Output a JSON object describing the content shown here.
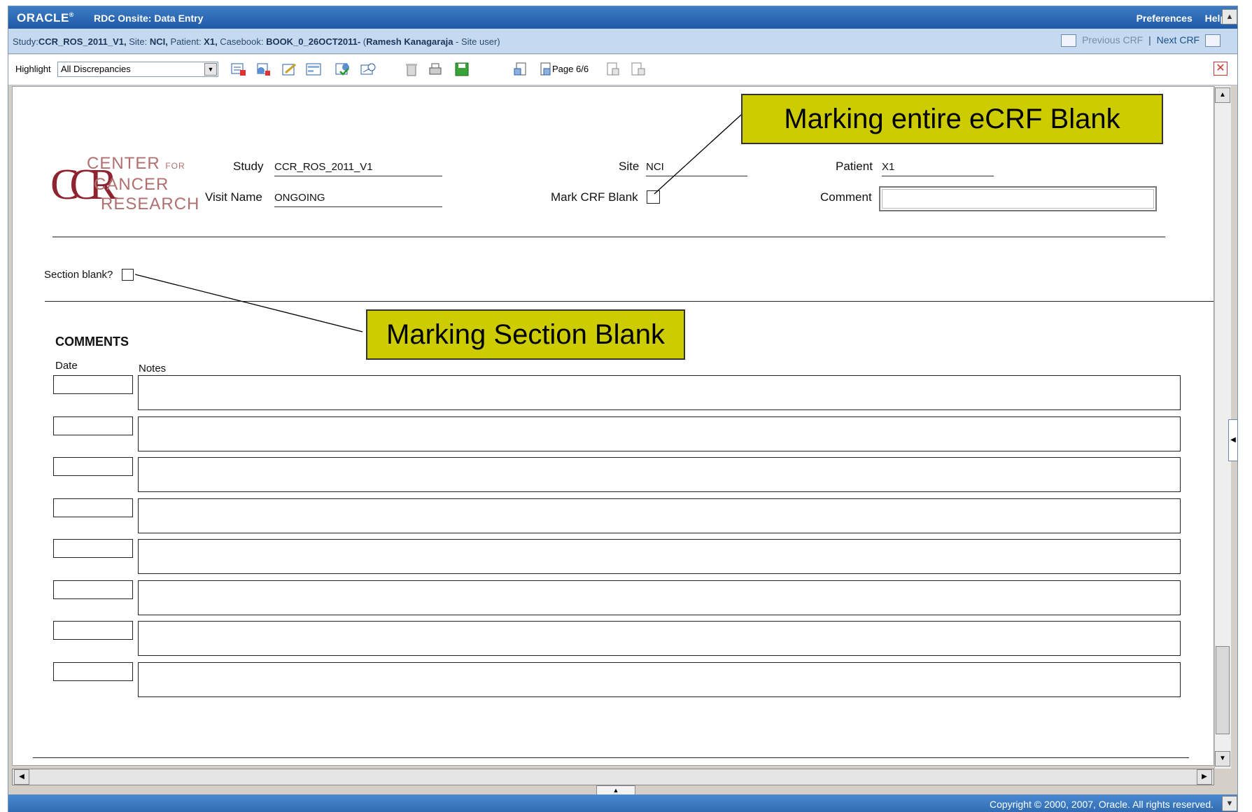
{
  "header": {
    "logo": "ORACLE",
    "logo_mark": "®",
    "app_title": "RDC Onsite: Data Entry",
    "preferences_label": "Preferences",
    "help_label": "Help"
  },
  "info_bar": {
    "study_prefix": "Study:",
    "study": "CCR_ROS_2011_V1,",
    "site_prefix": " Site: ",
    "site": "NCI,",
    "patient_prefix": " Patient: ",
    "patient": "X1,",
    "casebook_prefix": " Casebook: ",
    "casebook": "BOOK_0_26OCT2011-",
    "user_prefix": " (",
    "user": "Ramesh Kanagaraja",
    "role": " - Site user)",
    "previous_crf": "Previous CRF",
    "separator": "|",
    "next_crf": "Next CRF"
  },
  "toolbar": {
    "highlight_label": "Highlight",
    "highlight_value": "All Discrepancies",
    "page_label": "Page 6/6",
    "icons": [
      "add-discrepancy-icon",
      "add-investigator-comment-icon",
      "edit-icon",
      "audit-history-icon",
      "verify-icon",
      "approve-icon",
      "delete-icon",
      "print-icon",
      "save-icon",
      "first-page-icon",
      "previous-page-icon",
      "next-page-icon",
      "last-page-icon",
      "close-icon"
    ]
  },
  "form": {
    "logo_letters": "CCR",
    "logo_line1": "CENTER",
    "logo_line1_small": "FOR",
    "logo_line2": "CANCER",
    "logo_line3": "RESEARCH",
    "study_label": "Study",
    "study_value": "CCR_ROS_2011_V1",
    "site_label": "Site",
    "site_value": "NCI",
    "patient_label": "Patient",
    "patient_value": "X1",
    "visit_label": "Visit Name",
    "visit_value": "ONGOING",
    "mark_blank_label": "Mark CRF Blank",
    "comment_label": "Comment",
    "comment_value": "",
    "section_blank_label": "Section blank?",
    "comments_heading": "COMMENTS",
    "date_header": "Date",
    "notes_header": "Notes",
    "rows": [
      {
        "date": "",
        "notes": ""
      },
      {
        "date": "",
        "notes": ""
      },
      {
        "date": "",
        "notes": ""
      },
      {
        "date": "",
        "notes": ""
      },
      {
        "date": "",
        "notes": ""
      },
      {
        "date": "",
        "notes": ""
      },
      {
        "date": "",
        "notes": ""
      },
      {
        "date": "",
        "notes": ""
      }
    ]
  },
  "callouts": {
    "crf_blank": "Marking entire eCRF Blank",
    "section_blank": "Marking Section Blank"
  },
  "footer": {
    "copyright": "Copyright © 2000, 2007, Oracle. All rights reserved."
  },
  "colors": {
    "title_bar": "#1f5aa6",
    "info_bar": "#c5d9f1",
    "callout": "#cccc00",
    "logo_accent": "#8f2431"
  }
}
